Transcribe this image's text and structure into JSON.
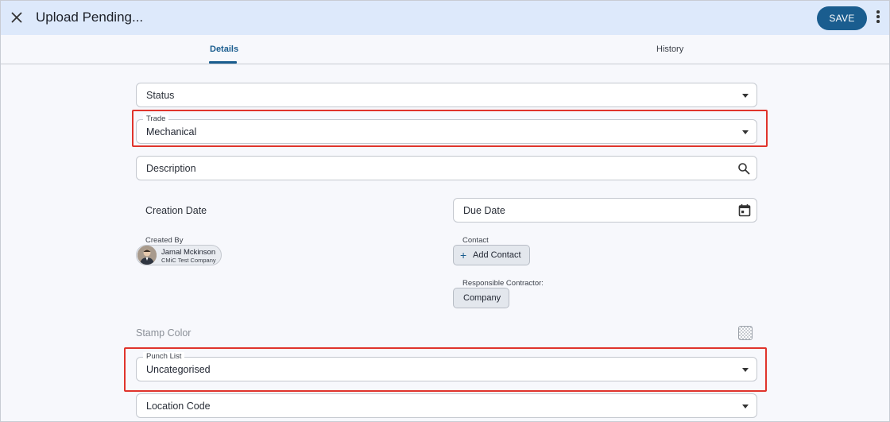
{
  "header": {
    "title": "Upload Pending...",
    "save_label": "SAVE"
  },
  "tabs": [
    {
      "label": "Details",
      "active": true
    },
    {
      "label": "History",
      "active": false
    }
  ],
  "form": {
    "status": {
      "placeholder": "Status"
    },
    "trade": {
      "label": "Trade",
      "value": "Mechanical"
    },
    "description": {
      "placeholder": "Description"
    },
    "creation_date": {
      "label": "Creation Date"
    },
    "due_date": {
      "placeholder": "Due Date"
    },
    "created_by": {
      "label": "Created By",
      "name": "Jamal Mckinson",
      "company": "CMiC Test Company"
    },
    "contact": {
      "label": "Contact",
      "button": "Add Contact"
    },
    "responsible_contractor": {
      "label": "Responsible Contractor:",
      "button": "Company"
    },
    "stamp_color": {
      "label": "Stamp Color"
    },
    "punch_list": {
      "label": "Punch List",
      "value": "Uncategorised"
    },
    "location_code": {
      "placeholder": "Location Code"
    }
  },
  "colors": {
    "accent": "#1a5d8f",
    "header_bg": "#dde9fb",
    "highlight": "#e0342c"
  }
}
